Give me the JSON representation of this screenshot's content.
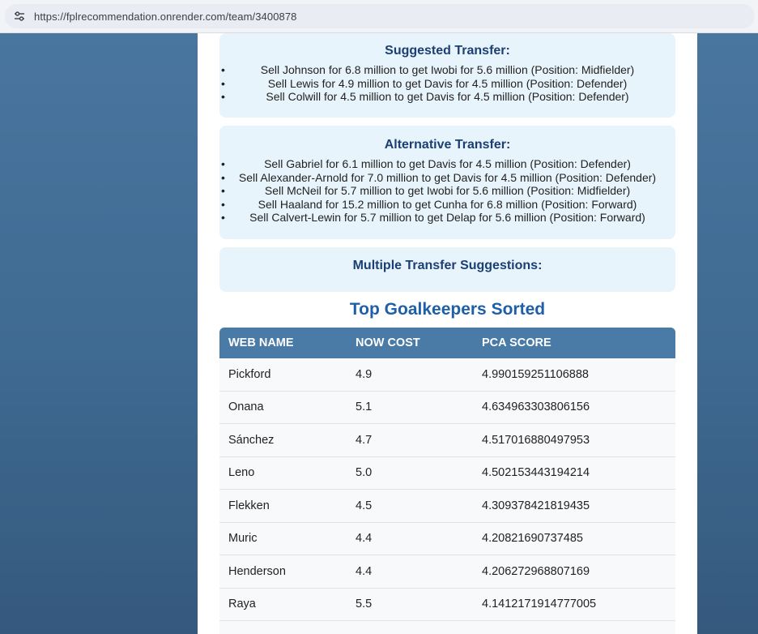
{
  "browser": {
    "url": "https://fplrecommendation.onrender.com/team/3400878",
    "site_settings_icon": "tune-icon"
  },
  "suggested": {
    "title": "Suggested Transfer:",
    "items": [
      "Sell Johnson for 6.8 million to get Iwobi for 5.6 million (Position: Midfielder)",
      "Sell Lewis for 4.9 million to get Davis for 4.5 million (Position: Defender)",
      "Sell Colwill for 4.5 million to get Davis for 4.5 million (Position: Defender)"
    ]
  },
  "alternative": {
    "title": "Alternative Transfer:",
    "items": [
      "Sell Gabriel for 6.1 million to get Davis for 4.5 million (Position: Defender)",
      "Sell Alexander-Arnold for 7.0 million to get Davis for 4.5 million (Position: Defender)",
      "Sell McNeil for 5.7 million to get Iwobi for 5.6 million (Position: Midfielder)",
      "Sell Haaland for 15.2 million to get Cunha for 6.8 million (Position: Forward)",
      "Sell Calvert-Lewin for 5.7 million to get Delap for 5.6 million (Position: Forward)"
    ]
  },
  "multiple": {
    "title": "Multiple Transfer Suggestions:"
  },
  "goalkeepers": {
    "title": "Top Goalkeepers Sorted",
    "columns": [
      "WEB NAME",
      "NOW COST",
      "PCA SCORE"
    ],
    "rows": [
      [
        "Pickford",
        "4.9",
        "4.990159251106888"
      ],
      [
        "Onana",
        "5.1",
        "4.634963303806156"
      ],
      [
        "Sánchez",
        "4.7",
        "4.517016880497953"
      ],
      [
        "Leno",
        "5.0",
        "4.502153443194214"
      ],
      [
        "Flekken",
        "4.5",
        "4.309378421819435"
      ],
      [
        "Muric",
        "4.4",
        "4.20821690737485"
      ],
      [
        "Henderson",
        "4.4",
        "4.206272968807169"
      ],
      [
        "Raya",
        "5.5",
        "4.1412171914777005"
      ]
    ]
  },
  "colors": {
    "page_background": "#4a77a0",
    "card_background": "#e8f4fb",
    "table_header": "#4a7aa6",
    "heading_blue": "#1f5fa8"
  }
}
